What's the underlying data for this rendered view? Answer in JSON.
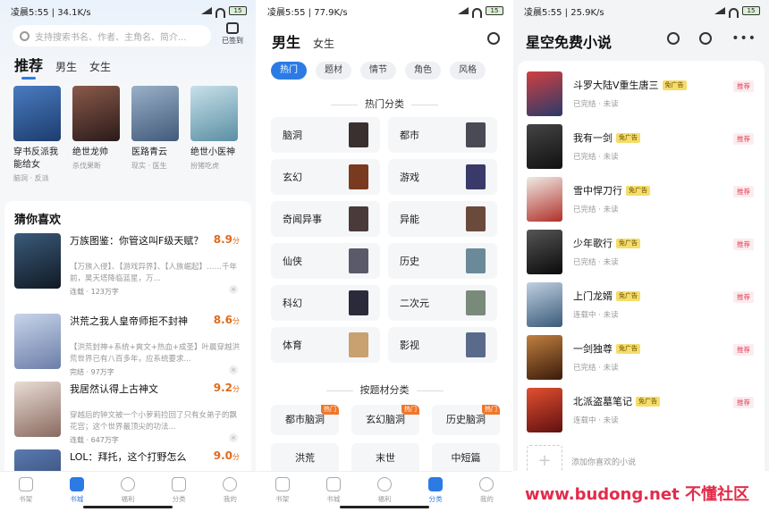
{
  "panel1": {
    "status": {
      "time": "凌晨5:55",
      "speed": "34.1K/s",
      "battery": "15"
    },
    "search": {
      "placeholder": "支持搜索书名、作者、主角名、简介..."
    },
    "checkin_label": "已签到",
    "tabs": [
      "推荐",
      "男生",
      "女生"
    ],
    "featured": [
      {
        "title": "穿书反派我能给女",
        "sub": "脑洞 · 反派",
        "color": "#1c3d6e"
      },
      {
        "title": "绝世龙帅",
        "sub": "杀伐果断",
        "color": "#3a2a2a"
      },
      {
        "title": "医路青云",
        "sub": "现实 · 医生",
        "color": "#415a7a"
      },
      {
        "title": "绝世小医神",
        "sub": "扮猪吃虎",
        "color": "#5a8fa3"
      }
    ],
    "guess_title": "猜你喜欢",
    "recs": [
      {
        "title": "万族图鉴：你管这叫F级天赋？",
        "score": "8.9",
        "unit": "分",
        "desc": "【万族入侵】、【游戏异界】、【人族崛起】……千年前，昊天塔降临蓝星，万...",
        "meta": "连载 · 123万字",
        "color": "#1d2a3a"
      },
      {
        "title": "洪荒之我人皇帝师拒不封神",
        "score": "8.6",
        "unit": "分",
        "desc": "【洪荒封神+系统+爽文+热血+成圣】叶晨穿越洪荒世界已有八百多年，应系统要求...",
        "meta": "完结 · 97万字",
        "color": "#6b7ea8"
      },
      {
        "title": "我居然认得上古神文",
        "score": "9.2",
        "unit": "分",
        "desc": "穿越后的钟文被一个小萝莉捡回了只有女弟子的飘花宫；这个世界最顶尖的功法...",
        "meta": "连载 · 647万字",
        "color": "#b8a9a0"
      },
      {
        "title": "LOL：拜托，这个打野怎么",
        "score": "9.0",
        "unit": "分",
        "desc": "",
        "meta": "",
        "color": "#2c3e66"
      }
    ],
    "nav": [
      {
        "label": "书架",
        "active": false
      },
      {
        "label": "书城",
        "active": true
      },
      {
        "label": "福利",
        "active": false
      },
      {
        "label": "分类",
        "active": false
      },
      {
        "label": "我的",
        "active": false
      }
    ]
  },
  "panel2": {
    "status": {
      "time": "凌晨5:55",
      "speed": "77.9K/s",
      "battery": "15"
    },
    "tabs": [
      "男生",
      "女生"
    ],
    "chips": [
      "热门",
      "题材",
      "情节",
      "角色",
      "风格"
    ],
    "hot_title": "热门分类",
    "categories": [
      {
        "label": "脑洞",
        "color": "#3a3030"
      },
      {
        "label": "都市",
        "color": "#4a4a55"
      },
      {
        "label": "玄幻",
        "color": "#7a3a20"
      },
      {
        "label": "游戏",
        "color": "#3a3a6a"
      },
      {
        "label": "奇闻异事",
        "color": "#4a3a3a"
      },
      {
        "label": "异能",
        "color": "#6a4a3a"
      },
      {
        "label": "仙侠",
        "color": "#5a5a6a"
      },
      {
        "label": "历史",
        "color": "#6a8a9a"
      },
      {
        "label": "科幻",
        "color": "#2a2a3a"
      },
      {
        "label": "二次元",
        "color": "#7a8a7a"
      },
      {
        "label": "体育",
        "color": "#c9a070"
      },
      {
        "label": "影视",
        "color": "#5a6a8a"
      }
    ],
    "theme_title": "按题材分类",
    "hot_badge": "热门",
    "themes": [
      {
        "label": "都市脑洞",
        "hot": true
      },
      {
        "label": "玄幻脑洞",
        "hot": true
      },
      {
        "label": "历史脑洞",
        "hot": true
      },
      {
        "label": "洪荒",
        "hot": false
      },
      {
        "label": "末世",
        "hot": false
      },
      {
        "label": "中短篇",
        "hot": false
      }
    ],
    "nav": [
      {
        "label": "书架",
        "active": false
      },
      {
        "label": "书城",
        "active": false
      },
      {
        "label": "福利",
        "active": false
      },
      {
        "label": "分类",
        "active": true
      },
      {
        "label": "我的",
        "active": false
      }
    ]
  },
  "panel3": {
    "status": {
      "time": "凌晨5:55",
      "speed": "25.9K/s",
      "battery": "15"
    },
    "title": "星空免费小说",
    "ad_badge": "免广告",
    "rec_badge": "推荐",
    "books": [
      {
        "title": "斗罗大陆V重生唐三",
        "status": "已完结 · 未读",
        "color": "#2a3a6a"
      },
      {
        "title": "我有一剑",
        "status": "已完结 · 未读",
        "color": "#1a1a1a"
      },
      {
        "title": "雪中悍刀行",
        "status": "已完结 · 未读",
        "color": "#d8d0c8"
      },
      {
        "title": "少年歌行",
        "status": "已完结 · 未读",
        "color": "#1a1a1a"
      },
      {
        "title": "上门龙婿",
        "status": "连载中 · 未读",
        "color": "#3a5a7a"
      },
      {
        "title": "一剑独尊",
        "status": "已完结 · 未读",
        "color": "#6a3a1a"
      },
      {
        "title": "北派盗墓笔记",
        "status": "连载中 · 未读",
        "color": "#b03020"
      }
    ],
    "add_text": "添加你喜欢的小说",
    "watermark": "www.budong.net 不懂社区"
  }
}
